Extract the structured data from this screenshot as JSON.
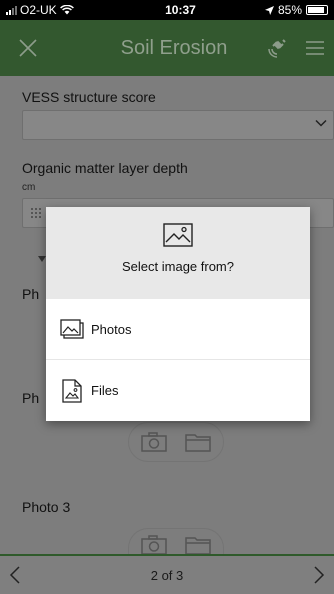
{
  "status_bar": {
    "carrier": "O2-UK",
    "time": "10:37",
    "battery": "85%"
  },
  "header": {
    "title": "Soil Erosion"
  },
  "form": {
    "vess_label": "VESS structure score",
    "organic_label": "Organic matter layer depth",
    "organic_unit": "cm",
    "photo1_label": "Ph",
    "photo2_label": "Ph",
    "photo3_label": "Photo 3"
  },
  "dialog": {
    "title": "Select image from?",
    "options": [
      {
        "label": "Photos",
        "icon": "photos-icon"
      },
      {
        "label": "Files",
        "icon": "files-icon"
      }
    ]
  },
  "footer": {
    "page_indicator": "2 of 3"
  }
}
